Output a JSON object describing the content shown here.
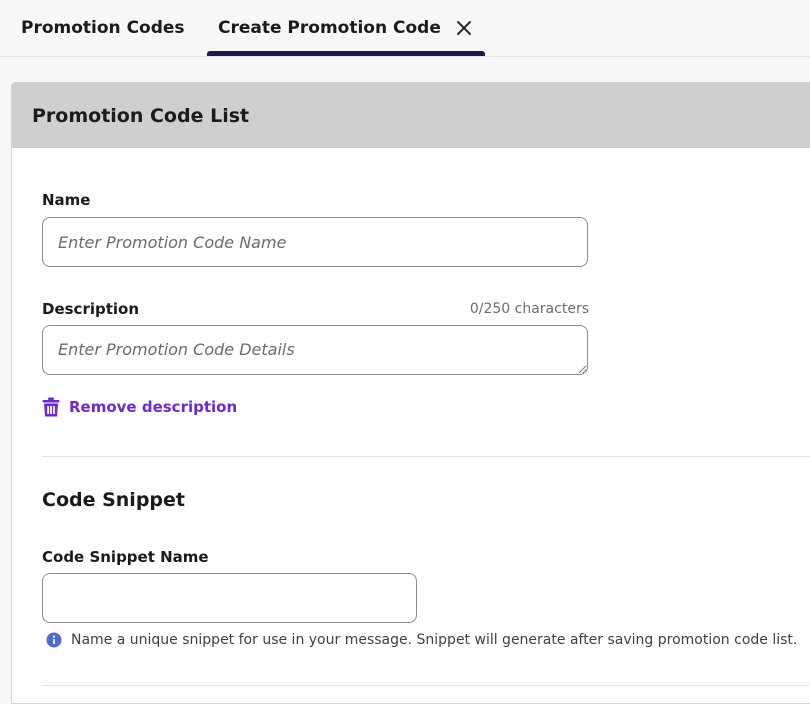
{
  "tabs": [
    {
      "label": "Promotion Codes",
      "active": false
    },
    {
      "label": "Create Promotion Code",
      "active": true
    }
  ],
  "icons": {
    "close": "close-icon",
    "trash": "trash-icon",
    "info": "info-icon"
  },
  "colors": {
    "accent": "#6d28d9",
    "tab_underline": "#1e1b4b",
    "header_bg": "#cfcfd1",
    "info": "#4f6ad8"
  },
  "card": {
    "title": "Promotion Code List"
  },
  "form": {
    "name": {
      "label": "Name",
      "placeholder": "Enter Promotion Code Name",
      "value": ""
    },
    "description": {
      "label": "Description",
      "placeholder": "Enter Promotion Code Details",
      "value": "",
      "counter": "0/250 characters"
    },
    "remove_description_label": "Remove description"
  },
  "code_snippet": {
    "title": "Code Snippet",
    "name_label": "Code Snippet Name",
    "value": "",
    "helper": "Name a unique snippet for use in your message. Snippet will generate after saving promotion code list."
  }
}
